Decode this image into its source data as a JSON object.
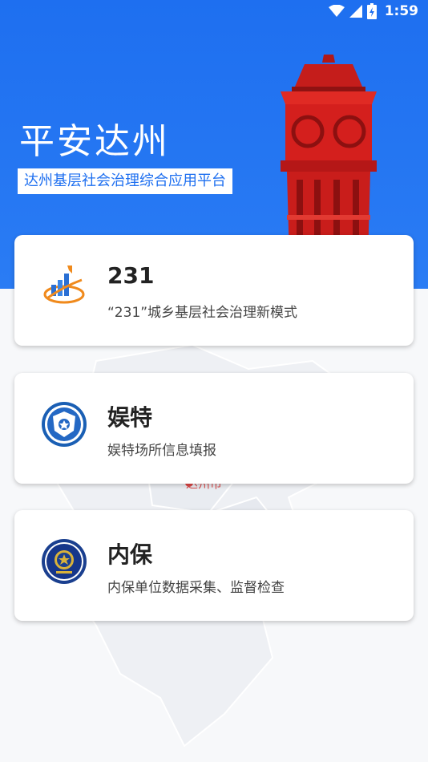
{
  "status_bar": {
    "time": "1:59"
  },
  "hero": {
    "title": "平安达州",
    "subtitle": "达州基层社会治理综合应用平台"
  },
  "map": {
    "label": "达州市"
  },
  "cards": [
    {
      "title": "231",
      "desc": "“231”城乡基层社会治理新模式",
      "icon": "bar-chart-logo-icon"
    },
    {
      "title": "娱特",
      "desc": "娱特场所信息填报",
      "icon": "police-badge-icon"
    },
    {
      "title": "内保",
      "desc": "内保单位数据采集、监督检查",
      "icon": "police-emblem-icon"
    }
  ],
  "colors": {
    "primary": "#1e6ff0",
    "tower": "#d8201e"
  }
}
